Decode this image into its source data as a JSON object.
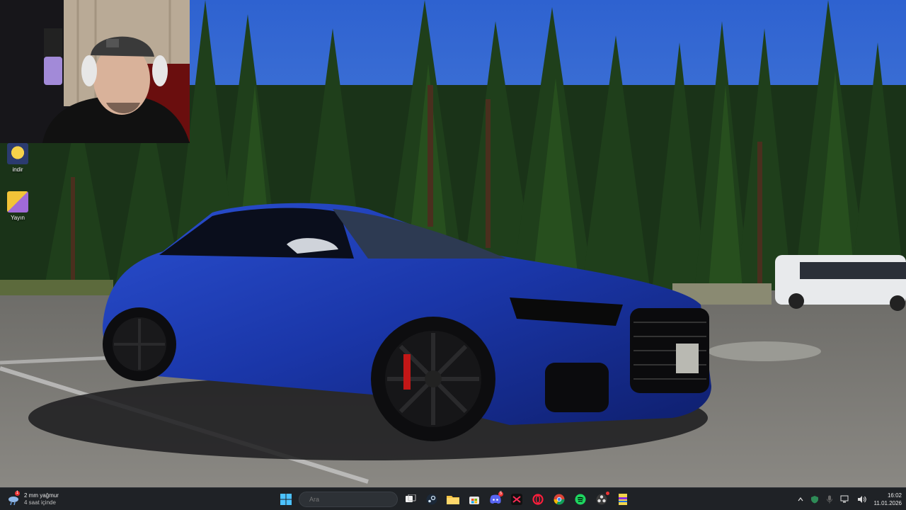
{
  "desktop": {
    "icons": [
      {
        "label": "indir"
      },
      {
        "label": "Yayın"
      }
    ]
  },
  "taskbar": {
    "weather": {
      "line1": "2 mm yağmur",
      "line2": "4 saat içinde",
      "badge": "1"
    },
    "search": {
      "placeholder": "Ara"
    },
    "apps": [
      "windows-start",
      "search",
      "task-view",
      "steam",
      "file-explorer",
      "microsoft-store",
      "discord",
      "capcut",
      "opera-gx",
      "chrome",
      "spotify",
      "obs",
      "winrar"
    ],
    "discord_badge": "5",
    "clock": {
      "time": "16:02",
      "date": "11.01.2026"
    }
  },
  "colors": {
    "taskbar_bg": "#1f2226",
    "car_blue": "#1c3fb8",
    "sky": "#3a6fd6"
  }
}
